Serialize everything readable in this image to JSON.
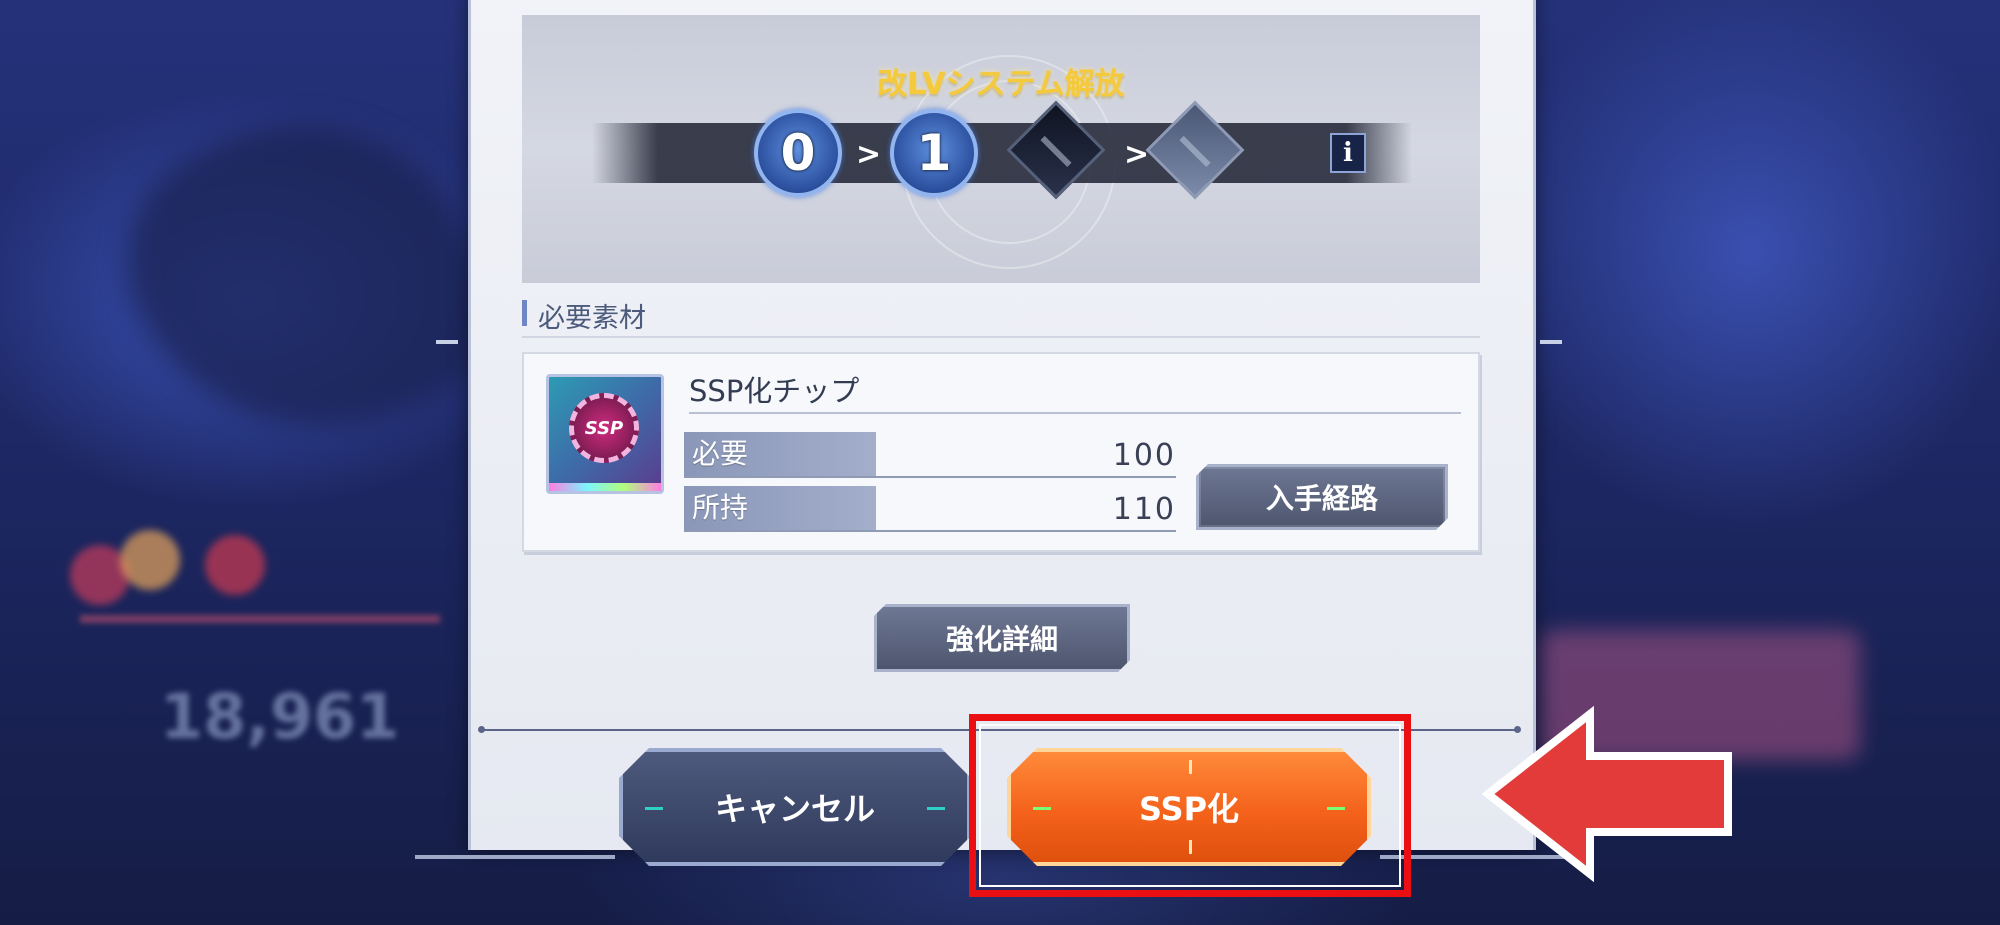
{
  "banner": {
    "title": "改LVシステム解放",
    "level_from": "0",
    "level_to": "1",
    "info_label": "i"
  },
  "materials_section": {
    "label": "必要素材"
  },
  "material": {
    "name": "SSP化チップ",
    "icon": "ssp-chip-icon",
    "icon_text": "SSP",
    "required_label": "必要",
    "required_value": "100",
    "owned_label": "所持",
    "owned_value": "110",
    "acquire_button": "入手経路"
  },
  "detail_button": "強化詳細",
  "buttons": {
    "cancel": "キャンセル",
    "confirm": "SSP化"
  },
  "background": {
    "blurred_number": "18,961"
  },
  "colors": {
    "confirm_button": "#f4621b",
    "highlight": "#e90f12",
    "title_gold": "#f4c93c",
    "level_blue": "#2a4f9d"
  }
}
